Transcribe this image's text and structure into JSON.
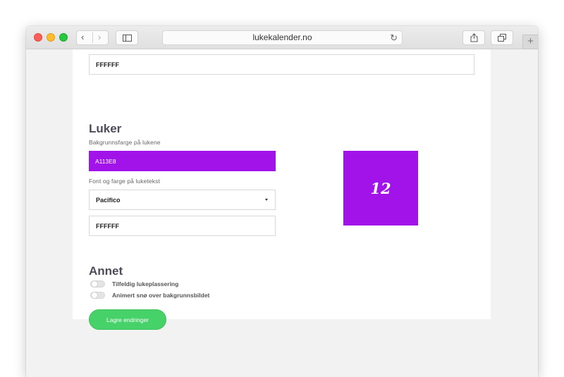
{
  "browser": {
    "url": "lukekalender.no",
    "newtab_symbol": "+"
  },
  "settings": {
    "prev_text_color": "FFFFFF",
    "hatches": {
      "title": "Luker",
      "bg_label": "Bakgrunnsfarge på lukene",
      "bg_value": "A113E8",
      "font_label": "Font og farge på luketekst",
      "font_value": "Pacifico",
      "text_color": "FFFFFF",
      "preview_number": "12"
    },
    "other": {
      "title": "Annet",
      "toggles": [
        {
          "label": "Tilfeldig lukeplassering",
          "on": false
        },
        {
          "label": "Animert snø over bakgrunnsbildet",
          "on": false
        }
      ]
    },
    "save_label": "Lagre endringer"
  },
  "colors": {
    "hatch_bg": "#a113e8",
    "save_button": "#46d169"
  }
}
